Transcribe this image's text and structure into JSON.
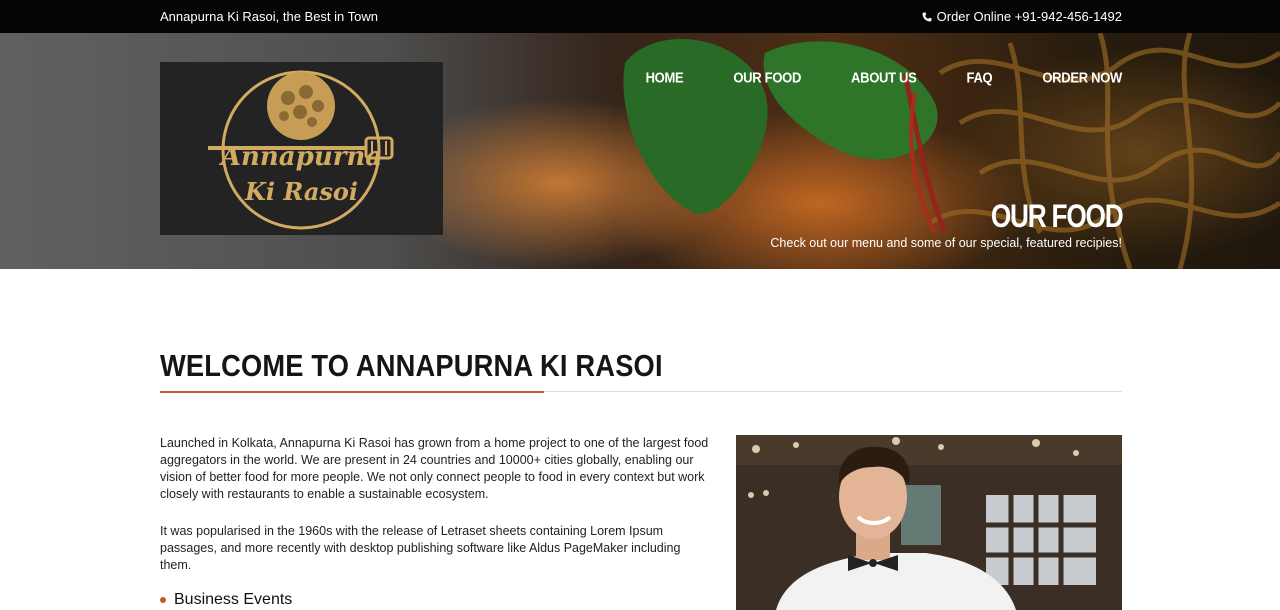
{
  "topbar": {
    "tagline": "Annapurna Ki Rasoi, the Best in Town",
    "phone_icon": "phone-icon",
    "order_text": "Order Online +91-942-456-1492"
  },
  "logo": {
    "line1": "Annapurna",
    "line2": "Ki Rasoi"
  },
  "nav": {
    "items": [
      "HOME",
      "OUR FOOD",
      "ABOUT US",
      "FAQ",
      "ORDER NOW"
    ]
  },
  "hero": {
    "title": "OUR FOOD",
    "subtitle": "Check out our menu and some of our special, featured recipies!"
  },
  "main": {
    "heading": "WELCOME TO ANNAPURNA KI RASOI",
    "paragraph1": "Launched in Kolkata, Annapurna Ki Rasoi has grown from a home project to one of the largest food aggregators in the world. We are present in 24 countries and 10000+ cities globally, enabling our vision of better food for more people. We not only connect people to food in every context but work closely with restaurants to enable a sustainable ecosystem.",
    "paragraph2": "It was popularised in the 1960s with the release of Letraset sheets containing Lorem Ipsum passages, and more recently with desktop publishing software like Aldus PageMaker including them.",
    "bullets": [
      "Business Events"
    ]
  },
  "colors": {
    "accent": "#c8552f",
    "logo_gold": "#d2aa62",
    "topbar_bg": "#050505"
  }
}
